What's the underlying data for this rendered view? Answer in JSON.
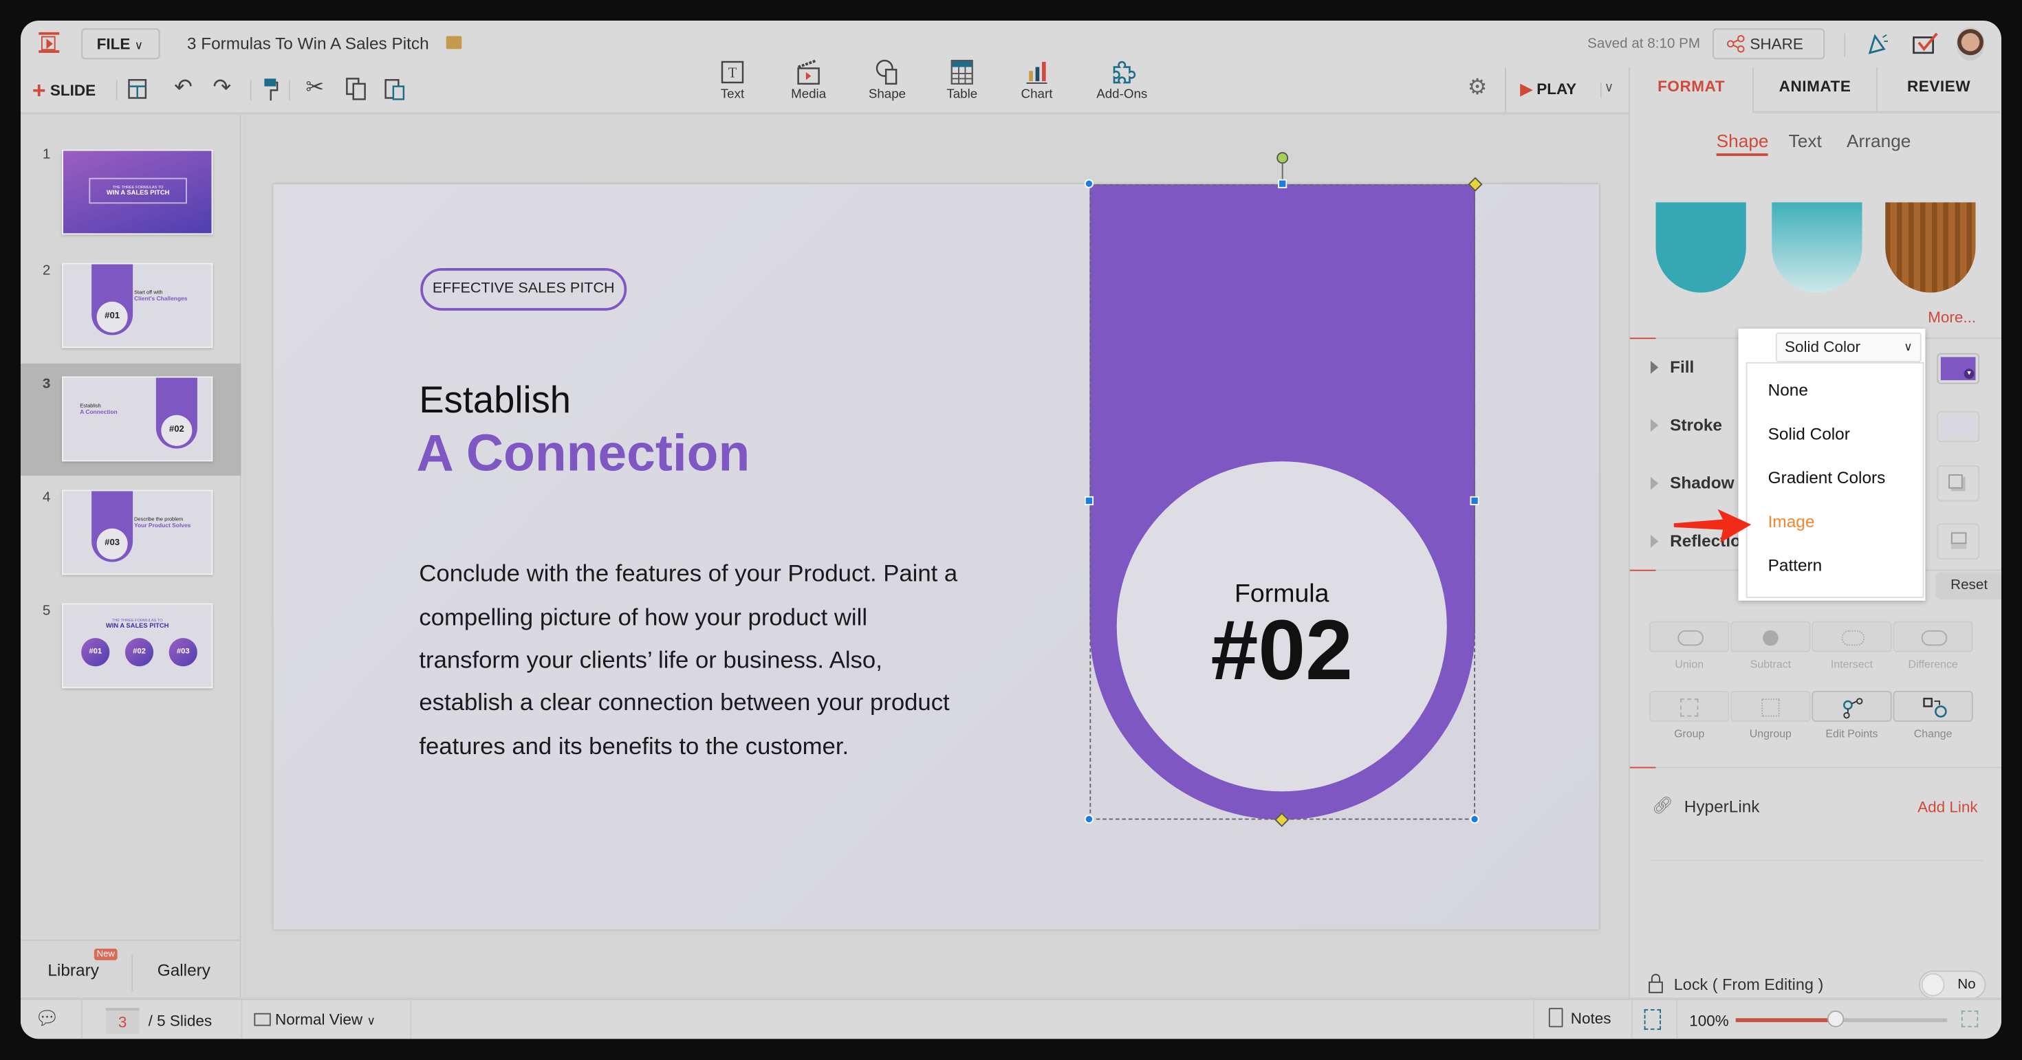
{
  "app": {
    "file_label": "FILE",
    "doc_title": "3 Formulas To Win A Sales Pitch",
    "saved_status": "Saved at 8:10 PM",
    "share_label": "SHARE"
  },
  "toolbar": {
    "slide_label": "SLIDE",
    "insert": [
      {
        "label": "Text",
        "icon": "text-box-icon"
      },
      {
        "label": "Media",
        "icon": "clapperboard-icon"
      },
      {
        "label": "Shape",
        "icon": "shape-icon"
      },
      {
        "label": "Table",
        "icon": "table-icon"
      },
      {
        "label": "Chart",
        "icon": "bar-chart-icon"
      },
      {
        "label": "Add-Ons",
        "icon": "puzzle-icon"
      }
    ],
    "play_label": "PLAY"
  },
  "right_tabs": [
    "FORMAT",
    "ANIMATE",
    "REVIEW"
  ],
  "format": {
    "subtabs": [
      "Shape",
      "Text",
      "Arrange"
    ],
    "more_label": "More...",
    "sections": [
      "Fill",
      "Stroke",
      "Shadow",
      "Reflection"
    ],
    "fill_type": "Solid Color",
    "fill_color": "#7e57c2",
    "fill_options": [
      "None",
      "Solid Color",
      "Gradient Colors",
      "Image",
      "Pattern"
    ],
    "highlighted_option": "Image",
    "reset_label": "Reset",
    "boolean_ops": [
      "Union",
      "Subtract",
      "Intersect",
      "Difference"
    ],
    "group_ops": [
      "Group",
      "Ungroup",
      "Edit Points",
      "Change"
    ],
    "hyperlink_label": "HyperLink",
    "add_link_label": "Add Link",
    "lock_label": "Lock ( From Editing )",
    "lock_value": "No"
  },
  "slides_panel": {
    "slides": [
      {
        "num": "1",
        "sub": "THE THREE FORMULAS TO",
        "title": "WIN A SALES PITCH"
      },
      {
        "num": "2",
        "formula": "#01",
        "line1": "Start off with",
        "line2": "Client's Challenges"
      },
      {
        "num": "3",
        "formula": "#02",
        "line1": "Establish",
        "line2": "A Connection"
      },
      {
        "num": "4",
        "formula": "#03",
        "line1": "Describe the problem",
        "line2": "Your Product Solves"
      },
      {
        "num": "5",
        "sub": "THE THREE FORMULAS TO",
        "title": "WIN A SALES PITCH",
        "circles": [
          "#01",
          "#02",
          "#03"
        ]
      }
    ],
    "library_label": "Library",
    "new_badge": "New",
    "gallery_label": "Gallery"
  },
  "slide": {
    "pill": "EFFECTIVE SALES PITCH",
    "heading1": "Establish",
    "heading2": "A Connection",
    "body": [
      "Conclude with the features of your Product. Paint a",
      "compelling picture of how your product will",
      "transform your clients’ life or business. Also,",
      "establish a clear connection between your product",
      "features and its benefits to the customer."
    ],
    "formula_label": "Formula",
    "formula_number": "#02",
    "accent": "#7e57c2"
  },
  "status": {
    "current_page": "3",
    "total": "/ 5 Slides",
    "view_label": "Normal View",
    "notes_label": "Notes",
    "zoom": "100%",
    "zoom_fraction": 0.47
  }
}
